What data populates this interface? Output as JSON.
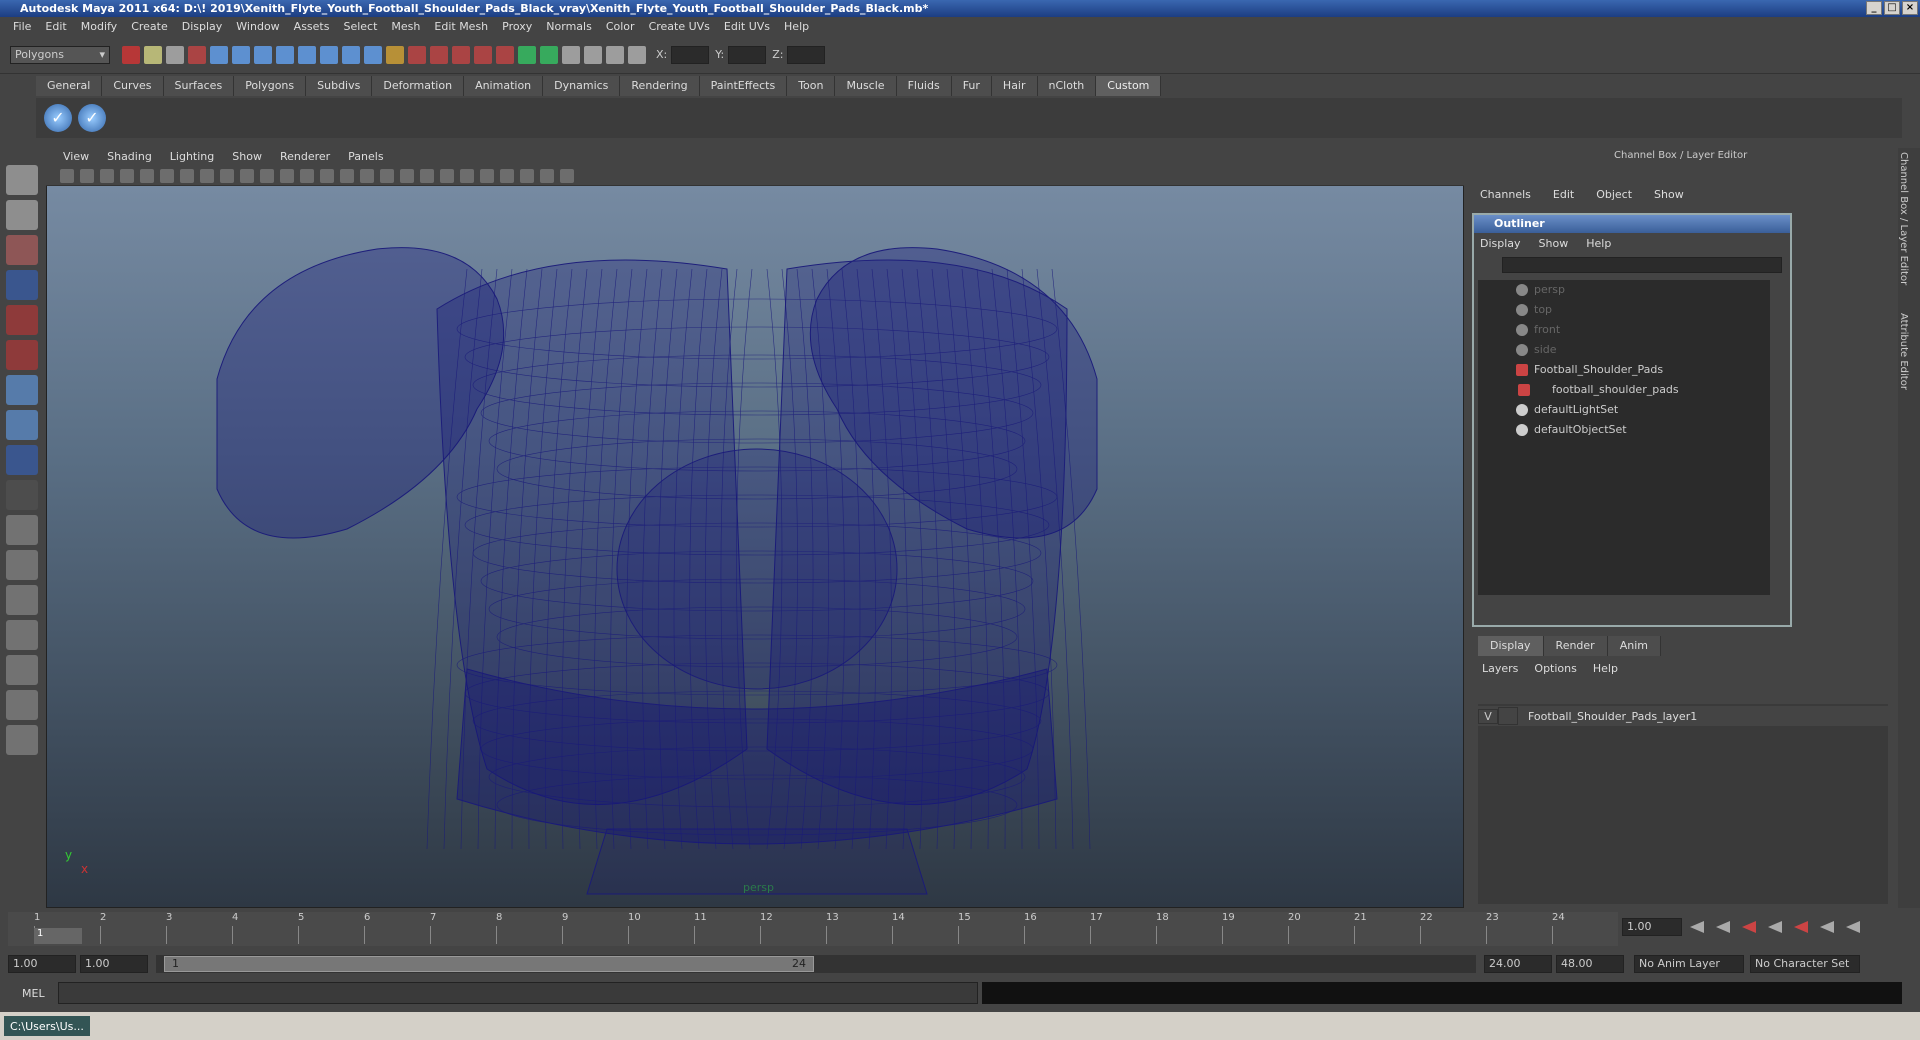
{
  "window": {
    "title": "Autodesk Maya 2011 x64: D:\\! 2019\\Xenith_Flyte_Youth_Football_Shoulder_Pads_Black_vray\\Xenith_Flyte_Youth_Football_Shoulder_Pads_Black.mb*"
  },
  "menubar": [
    "File",
    "Edit",
    "Modify",
    "Create",
    "Display",
    "Window",
    "Assets",
    "Select",
    "Mesh",
    "Edit Mesh",
    "Proxy",
    "Normals",
    "Color",
    "Create UVs",
    "Edit UVs",
    "Help"
  ],
  "status": {
    "mode": "Polygons",
    "x_label": "X:",
    "y_label": "Y:",
    "z_label": "Z:"
  },
  "shelf_tabs": [
    "General",
    "Curves",
    "Surfaces",
    "Polygons",
    "Subdivs",
    "Deformation",
    "Animation",
    "Dynamics",
    "Rendering",
    "PaintEffects",
    "Toon",
    "Muscle",
    "Fluids",
    "Fur",
    "Hair",
    "nCloth",
    "Custom"
  ],
  "viewport": {
    "menu": [
      "View",
      "Shading",
      "Lighting",
      "Show",
      "Renderer",
      "Panels"
    ],
    "camera_label": "persp",
    "axis_y": "y",
    "axis_x": "x"
  },
  "channel_box": {
    "title": "Channel Box / Layer Editor",
    "menu": [
      "Channels",
      "Edit",
      "Object",
      "Show"
    ]
  },
  "outliner": {
    "title": "Outliner",
    "menu": [
      "Display",
      "Show",
      "Help"
    ],
    "items": [
      {
        "label": "persp",
        "dim": true
      },
      {
        "label": "top",
        "dim": true
      },
      {
        "label": "front",
        "dim": true
      },
      {
        "label": "side",
        "dim": true
      },
      {
        "label": "Football_Shoulder_Pads",
        "dim": false
      },
      {
        "label": "football_shoulder_pads",
        "dim": false
      },
      {
        "label": "defaultLightSet",
        "dim": false
      },
      {
        "label": "defaultObjectSet",
        "dim": false
      }
    ]
  },
  "layer_editor": {
    "tabs": [
      "Display",
      "Render",
      "Anim"
    ],
    "menu": [
      "Layers",
      "Options",
      "Help"
    ],
    "layer_visibility": "V",
    "layer_name": "Football_Shoulder_Pads_layer1"
  },
  "timeline": {
    "ticks": [
      "1",
      "2",
      "3",
      "4",
      "5",
      "6",
      "7",
      "8",
      "9",
      "10",
      "11",
      "12",
      "13",
      "14",
      "15",
      "16",
      "17",
      "18",
      "19",
      "20",
      "21",
      "22",
      "23",
      "24"
    ],
    "current_frame": "1",
    "current_time": "1.00"
  },
  "range": {
    "start": "1.00",
    "playback_start": "1.00",
    "slider_start": "1",
    "slider_end": "24",
    "playback_end": "24.00",
    "end": "48.00",
    "anim_layer": "No Anim Layer",
    "character_set": "No Character Set"
  },
  "mel": {
    "label": "MEL"
  },
  "taskbar": {
    "item": "C:\\Users\\Us..."
  },
  "side_tabs": [
    "Channel Box / Layer Editor",
    "Attribute Editor"
  ],
  "colors": {
    "wire": "#1a1a7a",
    "bg": "#444444",
    "accent": "#6a8fc8"
  }
}
